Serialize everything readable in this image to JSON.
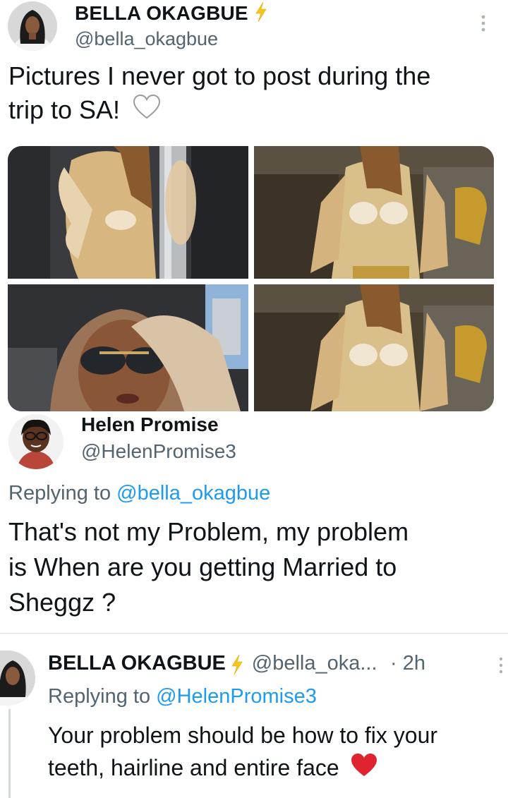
{
  "tweet": {
    "author_name": "BELLA OKAGBUE",
    "author_handle": "@bella_okagbue",
    "verified_icon": "lightning-bolt-icon",
    "text_line1": "Pictures I never got to post during the",
    "text_line2": "trip to SA!",
    "emoji": "white-heart-icon"
  },
  "reply": {
    "author_name": "Helen Promise",
    "author_handle": "@HelenPromise3",
    "replying_prefix": "Replying to",
    "replying_to": "@bella_okagbue",
    "text_line1": "That's not my Problem, my problem",
    "text_line2": "is  When are you getting Married to",
    "text_line3": "Sheggz ?"
  },
  "nested_reply": {
    "author_name": "BELLA OKAGBUE",
    "author_handle": "@bella_oka...",
    "time": "· 2h",
    "replying_prefix": "Replying to",
    "replying_to": "@HelenPromise3",
    "text_line1": "Your problem should be how to fix your",
    "text_line2": "teeth, hairline and entire face",
    "emoji": "red-heart-icon"
  },
  "colors": {
    "secondary_text": "#536471",
    "link": "#1d9bf0",
    "bolt": "#f5c518"
  }
}
